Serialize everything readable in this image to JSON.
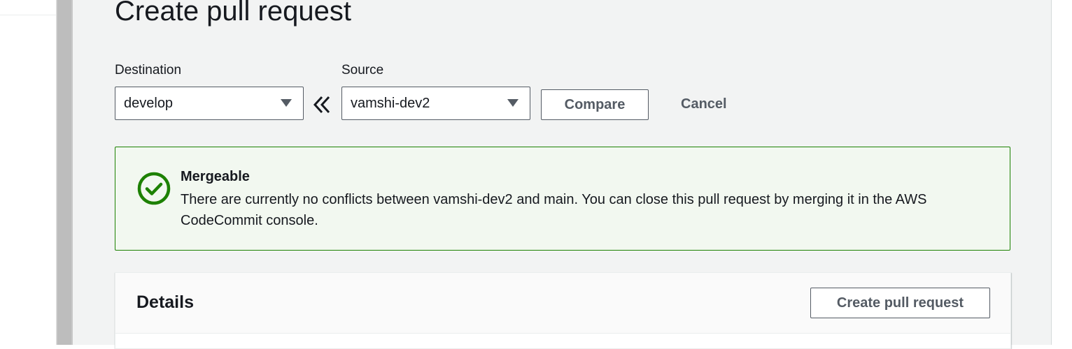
{
  "page": {
    "title": "Create pull request"
  },
  "destination": {
    "label": "Destination",
    "selected": "develop"
  },
  "source": {
    "label": "Source",
    "selected": "vamshi-dev2"
  },
  "actions": {
    "compare_label": "Compare",
    "cancel_label": "Cancel"
  },
  "alert": {
    "title": "Mergeable",
    "message": "There are currently no conflicts between vamshi-dev2 and main. You can close this pull request by merging it in the AWS CodeCommit console.",
    "icon": "check-circle-icon",
    "color": "#1d8102"
  },
  "details": {
    "title": "Details",
    "create_label": "Create pull request"
  },
  "colors": {
    "panel_bg": "#f2f3f3",
    "text": "#16191f",
    "button_text": "#545b64",
    "success": "#1d8102",
    "success_bg": "#f2f8f0"
  }
}
